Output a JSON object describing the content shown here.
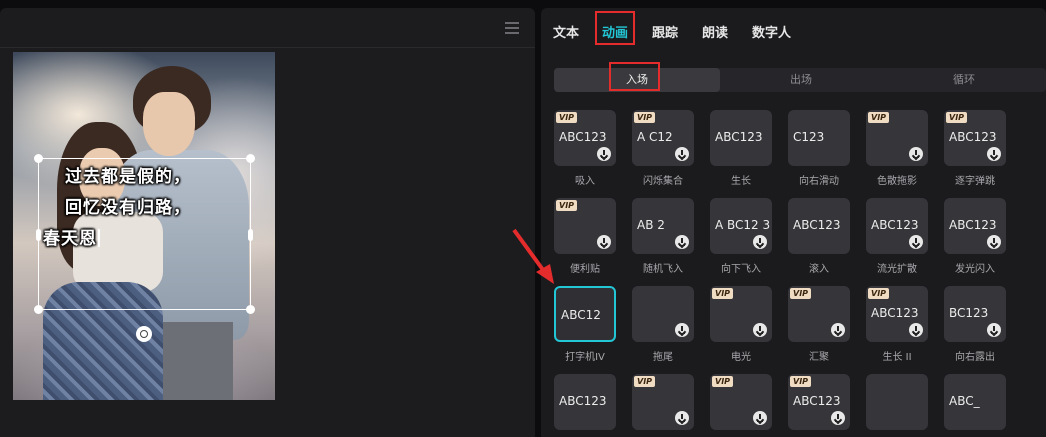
{
  "editor": {
    "menu_icon": "hamburger-menu-icon",
    "lyrics": [
      "过去都是假的，",
      "回忆没有归路，",
      "春天恩"
    ]
  },
  "panel": {
    "tabs": [
      "文本",
      "动画",
      "跟踪",
      "朗读",
      "数字人"
    ],
    "active_tab": "动画",
    "subtabs": [
      "入场",
      "出场",
      "循环"
    ],
    "active_subtab": "入场",
    "accent_color": "#22c6d4",
    "highlight_color": "#e52c2c"
  },
  "effects": [
    {
      "label": "吸入",
      "vip": true,
      "download": true,
      "preview": "ABC123"
    },
    {
      "label": "闪烁集合",
      "vip": true,
      "download": true,
      "preview": "A C12"
    },
    {
      "label": "生长",
      "vip": false,
      "download": false,
      "preview": "ABC123"
    },
    {
      "label": "向右滑动",
      "vip": false,
      "download": false,
      "preview": "C123"
    },
    {
      "label": "色散拖影",
      "vip": true,
      "download": true,
      "preview": ""
    },
    {
      "label": "逐字弹跳",
      "vip": true,
      "download": true,
      "preview": "ABC123"
    },
    {
      "label": "便利贴",
      "vip": true,
      "download": true,
      "preview": ""
    },
    {
      "label": "随机飞入",
      "vip": false,
      "download": true,
      "preview": "AB 2"
    },
    {
      "label": "向下飞入",
      "vip": false,
      "download": true,
      "preview": "A BC12 3"
    },
    {
      "label": "滚入",
      "vip": false,
      "download": false,
      "preview": "ABC123"
    },
    {
      "label": "流光扩散",
      "vip": false,
      "download": true,
      "preview": "ABC123"
    },
    {
      "label": "发光闪入",
      "vip": false,
      "download": true,
      "preview": "ABC123"
    },
    {
      "label": "打字机IV",
      "vip": false,
      "download": false,
      "preview": "ABC12",
      "selected": true
    },
    {
      "label": "拖尾",
      "vip": false,
      "download": true,
      "preview": ""
    },
    {
      "label": "电光",
      "vip": true,
      "download": true,
      "preview": ""
    },
    {
      "label": "汇聚",
      "vip": true,
      "download": true,
      "preview": ""
    },
    {
      "label": "生长 II",
      "vip": true,
      "download": true,
      "preview": "ABC123"
    },
    {
      "label": "向右露出",
      "vip": false,
      "download": true,
      "preview": "BC123"
    },
    {
      "label": "",
      "vip": false,
      "download": false,
      "preview": "ABC123"
    },
    {
      "label": "",
      "vip": true,
      "download": true,
      "preview": ""
    },
    {
      "label": "",
      "vip": true,
      "download": true,
      "preview": ""
    },
    {
      "label": "",
      "vip": true,
      "download": true,
      "preview": "ABC123"
    },
    {
      "label": "",
      "vip": false,
      "download": false,
      "preview": ""
    },
    {
      "label": "",
      "vip": false,
      "download": false,
      "preview": "ABC_"
    }
  ],
  "vip_text": "VIP"
}
